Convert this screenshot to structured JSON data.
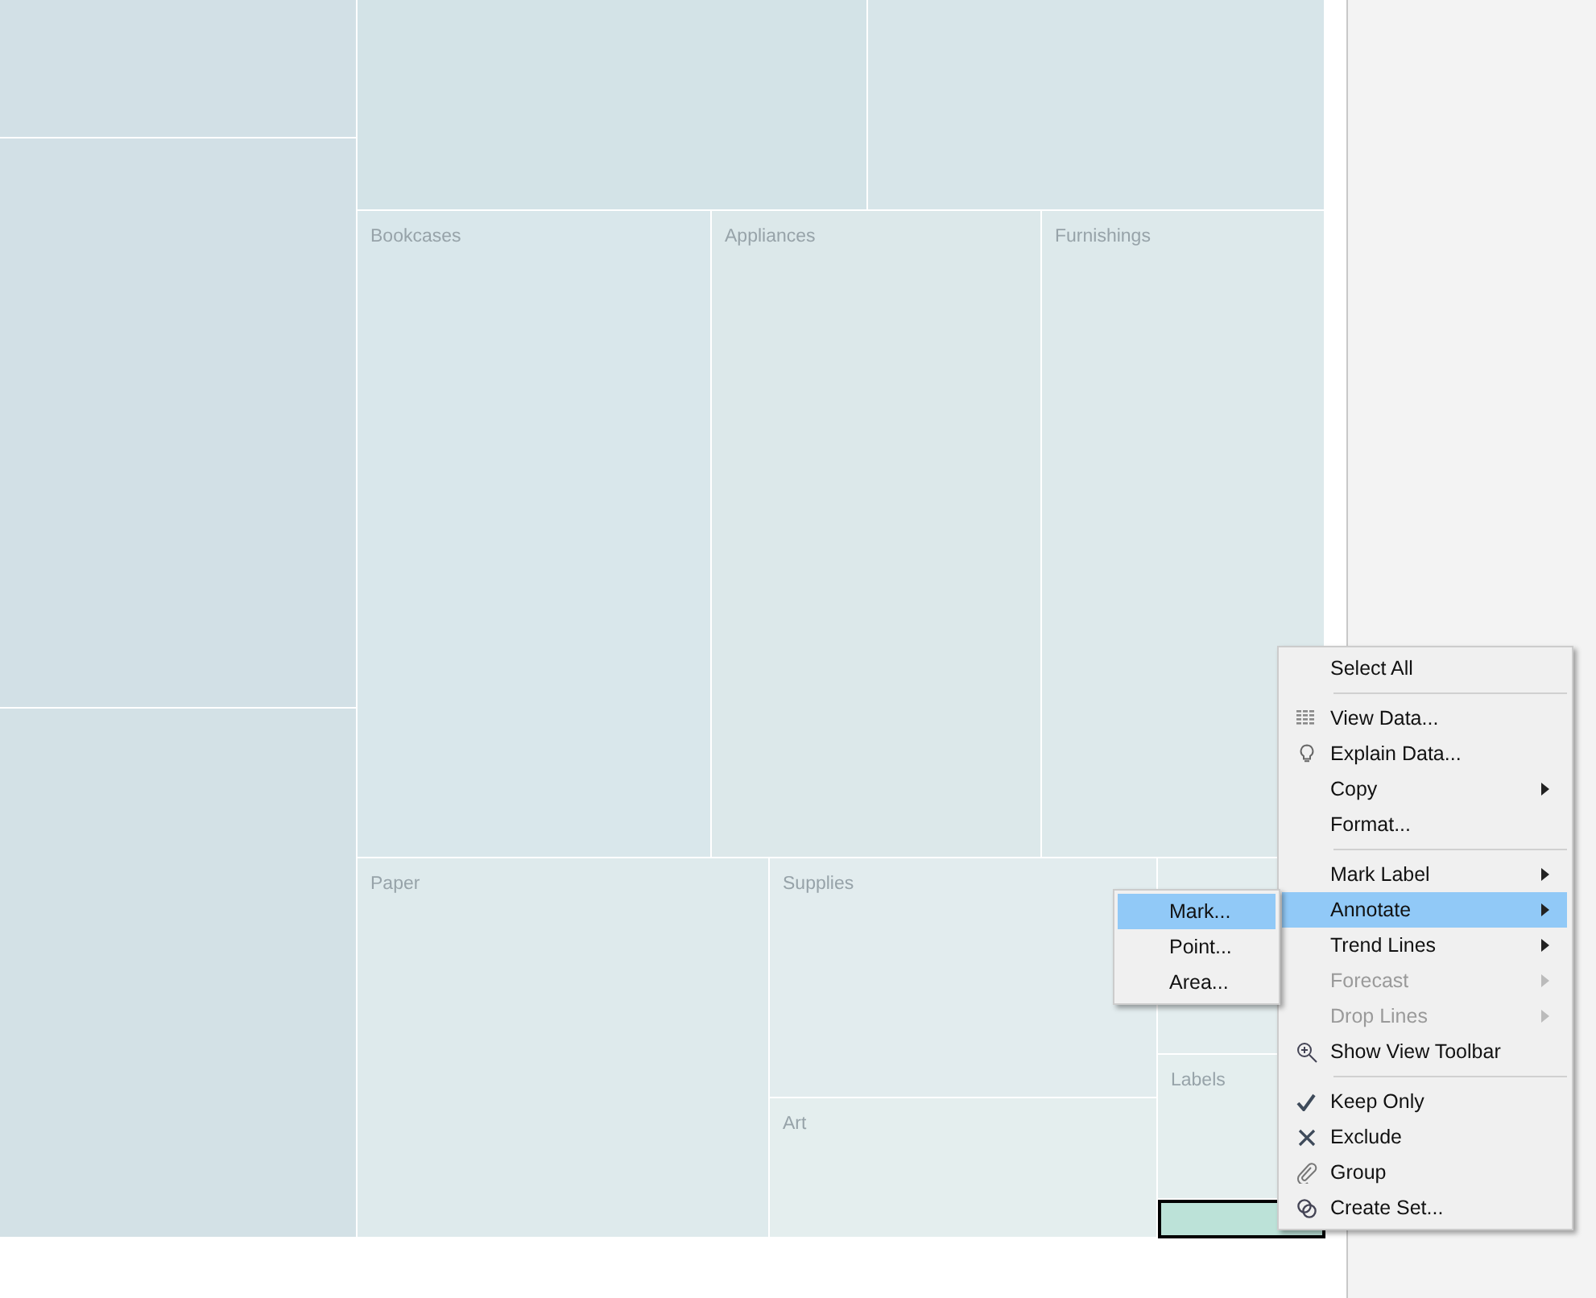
{
  "treemap": {
    "tiles": [
      {
        "color": "#d2e0e6",
        "selected": false
      },
      {
        "color": "#d2e0e6",
        "selected": false
      },
      {
        "color": "#d3e1e6",
        "selected": false
      },
      {
        "color": "#d3e3e7",
        "selected": false
      },
      {
        "color": "#d7e5e9",
        "selected": false
      },
      {
        "label": "Bookcases",
        "color": "#d9e7eb",
        "selected": false
      },
      {
        "label": "Appliances",
        "color": "#dce8ea",
        "selected": false
      },
      {
        "label": "Furnishings",
        "color": "#dde9eb",
        "selected": false
      },
      {
        "label": "Paper",
        "color": "#deeaec",
        "selected": false
      },
      {
        "label": "Supplies",
        "color": "#e2ecee",
        "selected": false
      },
      {
        "label": "Art",
        "color": "#e4eeee",
        "selected": false
      },
      {
        "color": "#e3edee",
        "selected": false
      },
      {
        "label": "Labels",
        "color": "#e4eeee",
        "selected": false
      },
      {
        "color": "#bce2d8",
        "selected": true
      }
    ]
  },
  "context_menu": {
    "items": [
      {
        "kind": "item",
        "label": "Select All",
        "submenu": false,
        "disabled": false,
        "selected": false
      },
      {
        "kind": "separator"
      },
      {
        "kind": "item",
        "label": "View Data...",
        "submenu": false,
        "disabled": false,
        "selected": false
      },
      {
        "kind": "item",
        "label": "Explain Data...",
        "submenu": false,
        "disabled": false,
        "selected": false
      },
      {
        "kind": "item",
        "label": "Copy",
        "submenu": true,
        "disabled": false,
        "selected": false
      },
      {
        "kind": "item",
        "label": "Format...",
        "submenu": false,
        "disabled": false,
        "selected": false
      },
      {
        "kind": "separator"
      },
      {
        "kind": "item",
        "label": "Mark Label",
        "submenu": true,
        "disabled": false,
        "selected": false
      },
      {
        "kind": "item",
        "label": "Annotate",
        "submenu": true,
        "disabled": false,
        "selected": true
      },
      {
        "kind": "item",
        "label": "Trend Lines",
        "submenu": true,
        "disabled": false,
        "selected": false
      },
      {
        "kind": "item",
        "label": "Forecast",
        "submenu": true,
        "disabled": true,
        "selected": false
      },
      {
        "kind": "item",
        "label": "Drop Lines",
        "submenu": true,
        "disabled": true,
        "selected": false
      },
      {
        "kind": "item",
        "label": "Show View Toolbar",
        "submenu": false,
        "disabled": false,
        "selected": false
      },
      {
        "kind": "separator"
      },
      {
        "kind": "item",
        "label": "Keep Only",
        "submenu": false,
        "disabled": false,
        "selected": false
      },
      {
        "kind": "item",
        "label": "Exclude",
        "submenu": false,
        "disabled": false,
        "selected": false
      },
      {
        "kind": "item",
        "label": "Group",
        "submenu": false,
        "disabled": false,
        "selected": false
      },
      {
        "kind": "item",
        "label": "Create Set...",
        "submenu": false,
        "disabled": false,
        "selected": false
      }
    ]
  },
  "submenu": {
    "items": [
      {
        "label": "Mark...",
        "selected": true
      },
      {
        "label": "Point...",
        "selected": false
      },
      {
        "label": "Area...",
        "selected": false
      }
    ]
  }
}
